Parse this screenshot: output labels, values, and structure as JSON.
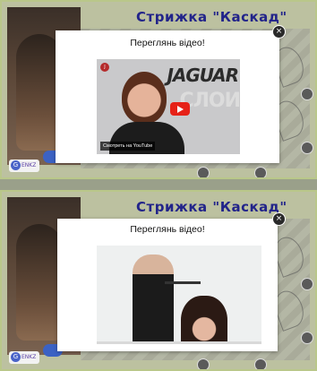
{
  "slides": [
    {
      "title": "Стрижка \"Каскад\"",
      "modal": {
        "heading": "Переглянь відео!",
        "close_label": "×",
        "video": {
          "overlay_brand": "JAGUAR",
          "overlay_brand2": "СЛОИ",
          "channel_logo": "J",
          "watch_on_label": "Смотреть на YouTube"
        }
      },
      "brand_badge": "ENKZ"
    },
    {
      "title": "Стрижка \"Каскад\"",
      "modal": {
        "heading": "Переглянь відео!",
        "close_label": "×"
      },
      "brand_badge": "ENKZ"
    }
  ],
  "colors": {
    "title": "#22248a",
    "panel_bg": "#bcc1a0",
    "play_button": "#e62117"
  }
}
